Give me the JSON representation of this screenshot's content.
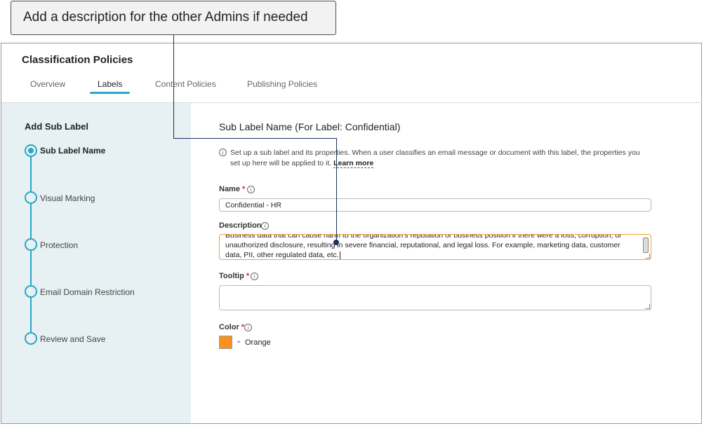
{
  "callout": {
    "text": "Add a description for the other Admins if needed"
  },
  "page": {
    "title": "Classification Policies"
  },
  "tabs": [
    {
      "label": "Overview"
    },
    {
      "label": "Labels"
    },
    {
      "label": "Content Policies"
    },
    {
      "label": "Publishing Policies"
    }
  ],
  "sidebar": {
    "title": "Add Sub Label",
    "steps": [
      {
        "label": "Sub Label Name"
      },
      {
        "label": "Visual Marking"
      },
      {
        "label": "Protection"
      },
      {
        "label": "Email Domain Restriction"
      },
      {
        "label": "Review and Save"
      }
    ]
  },
  "main": {
    "title": "Sub Label Name (For Label: Confidential)",
    "info_text": "Set up a sub label and its properties. When a user classifies an email message or document with this label, the properties you set up here will be applied to it.",
    "learn_more": "Learn more",
    "name": {
      "label": "Name",
      "required_mark": "*",
      "value": "Confidential - HR"
    },
    "description": {
      "label": "Description",
      "value": "Business data that can cause harm to the organization's reputation or business position if there were a loss, corruption, or unauthorized disclosure, resulting in severe financial, reputational, and legal loss. For example, marketing data, customer data, PII, other regulated data, etc."
    },
    "tooltip": {
      "label": "Tooltip",
      "required_mark": "*",
      "value": ""
    },
    "color": {
      "label": "Color",
      "required_mark": "*",
      "value": "Orange",
      "swatch_hex": "#f7931e"
    }
  },
  "colors": {
    "accent": "#2aa7c6",
    "sidebar_bg": "#e7f0f2",
    "required": "#d9232d",
    "focus_border": "#f0a52a",
    "leader": "#1f2f5a"
  }
}
